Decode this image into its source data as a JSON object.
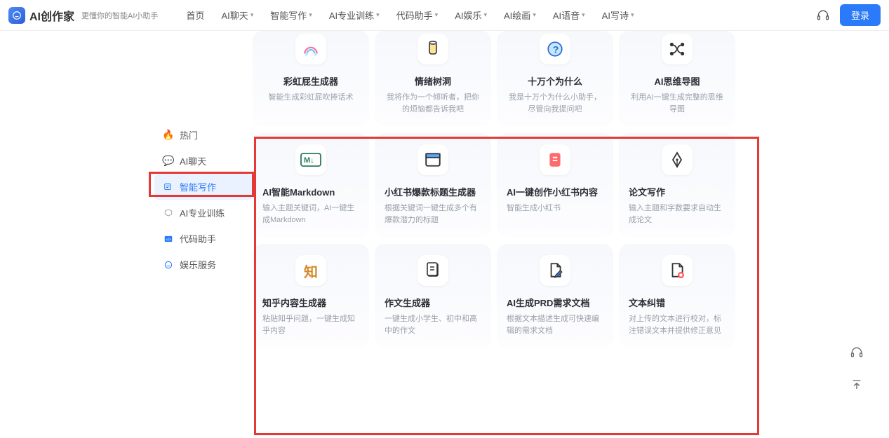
{
  "header": {
    "brand": "AI创作家",
    "tagline": "更懂你的智能AI小助手",
    "nav": [
      "首页",
      "AI聊天",
      "智能写作",
      "AI专业训练",
      "代码助手",
      "AI娱乐",
      "AI绘画",
      "AI语音",
      "AI写诗"
    ],
    "login": "登录"
  },
  "sidebar": {
    "items": [
      {
        "label": "热门"
      },
      {
        "label": "AI聊天"
      },
      {
        "label": "智能写作"
      },
      {
        "label": "AI专业训练"
      },
      {
        "label": "代码助手"
      },
      {
        "label": "娱乐服务"
      }
    ],
    "activeIndex": 2
  },
  "cards_row0": [
    {
      "title": "彩虹屁生成器",
      "desc": "智能生成彩虹屁吹捧话术"
    },
    {
      "title": "情绪树洞",
      "desc": "我将作为一个倾听者，把你的烦恼都告诉我吧"
    },
    {
      "title": "十万个为什么",
      "desc": "我是十万个为什么小助手，尽管向我提问吧"
    },
    {
      "title": "AI思维导图",
      "desc": "利用AI一键生成完整的思维导图"
    }
  ],
  "cards_row1": [
    {
      "title": "AI智能Markdown",
      "desc": "输入主题关键词，AI一键生成Markdown"
    },
    {
      "title": "小红书爆款标题生成器",
      "desc": "根据关键词一键生成多个有爆款潜力的标题"
    },
    {
      "title": "AI一键创作小红书内容",
      "desc": "智能生成小红书"
    },
    {
      "title": "论文写作",
      "desc": "输入主题和字数要求自动生成论文"
    }
  ],
  "cards_row2": [
    {
      "title": "知乎内容生成器",
      "desc": "粘贴知乎问题，一键生成知乎内容"
    },
    {
      "title": "作文生成器",
      "desc": "一键生成小学生、初中和高中的作文"
    },
    {
      "title": "AI生成PRD需求文档",
      "desc": "根据文本描述生成可快速编辑的需求文档"
    },
    {
      "title": "文本纠错",
      "desc": "对上传的文本进行校对，标注错误文本并提供修正意见"
    }
  ]
}
